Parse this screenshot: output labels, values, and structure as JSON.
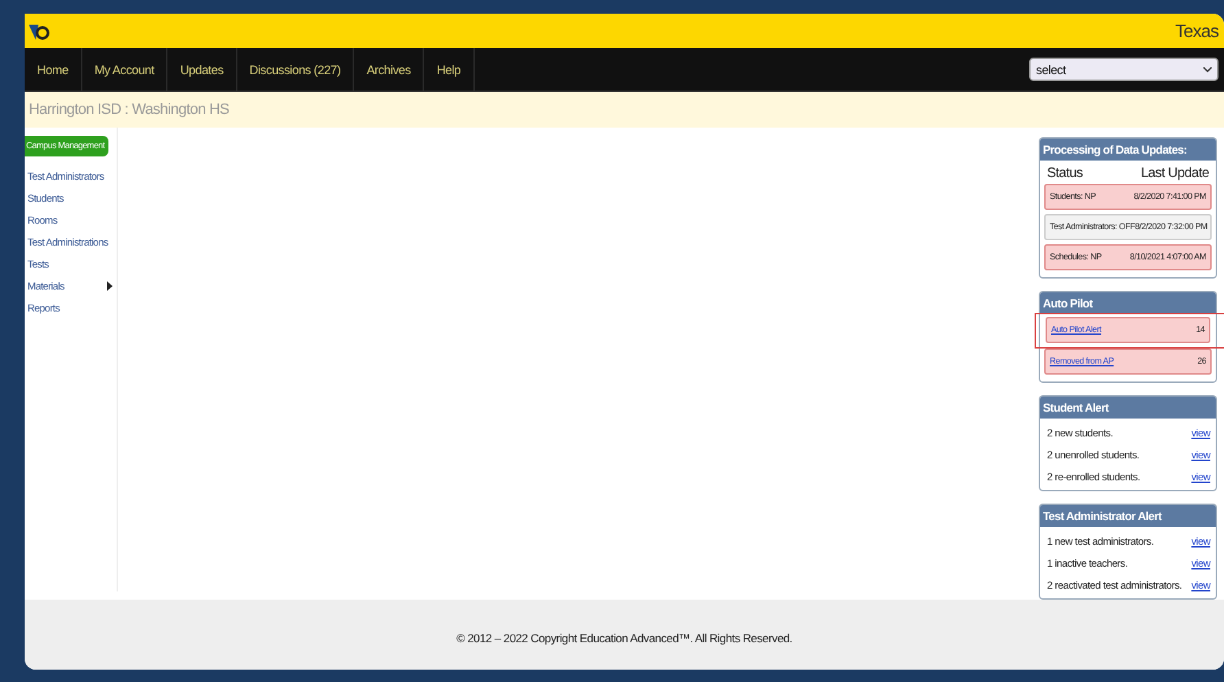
{
  "header": {
    "region": "Texas"
  },
  "nav": {
    "items": [
      {
        "label": "Home"
      },
      {
        "label": "My Account"
      },
      {
        "label": "Updates"
      },
      {
        "label": "Discussions (227)"
      },
      {
        "label": "Archives"
      },
      {
        "label": "Help"
      }
    ],
    "select": {
      "value": "select"
    }
  },
  "breadcrumb": "Harrington ISD : Washington HS",
  "sidebar": {
    "heading": "Campus Management",
    "items": [
      {
        "label": "Test Administrators",
        "submenu": false
      },
      {
        "label": "Students",
        "submenu": false
      },
      {
        "label": "Rooms",
        "submenu": false
      },
      {
        "label": "Test Administrations",
        "submenu": false
      },
      {
        "label": "Tests",
        "submenu": false
      },
      {
        "label": "Materials",
        "submenu": true
      },
      {
        "label": "Reports",
        "submenu": false
      }
    ]
  },
  "processing": {
    "title": "Processing of Data Updates:",
    "columns": [
      "Status",
      "Last Update"
    ],
    "rows": [
      {
        "status": "Students: NP",
        "last_update": "8/2/2020 7:41:00 PM",
        "alert": true
      },
      {
        "status": "Test Administrators: OFF",
        "last_update": "8/2/2020 7:32:00 PM",
        "alert": false
      },
      {
        "status": "Schedules: NP",
        "last_update": "8/10/2021 4:07:00 AM",
        "alert": true
      }
    ]
  },
  "auto_pilot": {
    "title": "Auto Pilot",
    "rows": [
      {
        "label": "Auto Pilot Alert",
        "count": "14",
        "highlighted": true
      },
      {
        "label": "Removed from AP",
        "count": "26",
        "highlighted": false
      }
    ]
  },
  "student_alert": {
    "title": "Student Alert",
    "rows": [
      {
        "text": "2 new students.",
        "link": "view"
      },
      {
        "text": "2 unenrolled students.",
        "link": "view"
      },
      {
        "text": "2 re-enrolled students.",
        "link": "view"
      }
    ]
  },
  "admin_alert": {
    "title": "Test Administrator Alert",
    "rows": [
      {
        "text": "1 new test administrators.",
        "link": "view"
      },
      {
        "text": "1 inactive teachers.",
        "link": "view"
      },
      {
        "text": "2 reactivated test administrators.",
        "link": "view"
      }
    ]
  },
  "footer": "© 2012 – 2022 Copyright Education Advanced™. All Rights Reserved."
}
